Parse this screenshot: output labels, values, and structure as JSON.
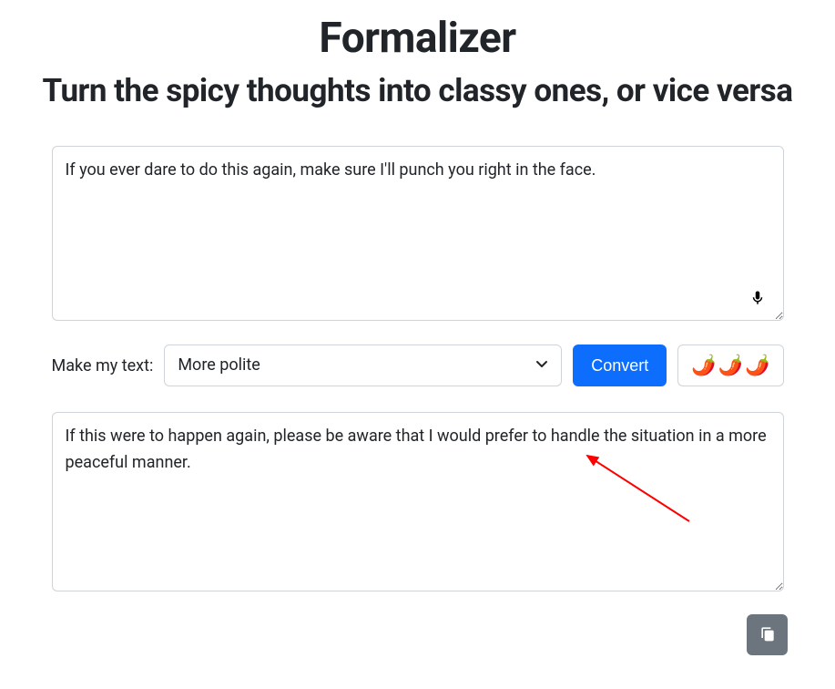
{
  "title": "Formalizer",
  "subtitle": "Turn the spicy thoughts into classy ones, or vice versa",
  "input_text": "If you ever dare to do this again, make sure I'll punch you right in the face.",
  "controls": {
    "label": "Make my text:",
    "tone_selected": "More polite",
    "convert_label": "Convert"
  },
  "output_text": "If this were to happen again, please be aware that I would prefer to handle the situation in a more peaceful manner.",
  "icons": {
    "mic": "microphone-icon",
    "chevron": "chevron-down-icon",
    "chili": "🌶️",
    "copy": "copy-icon"
  }
}
